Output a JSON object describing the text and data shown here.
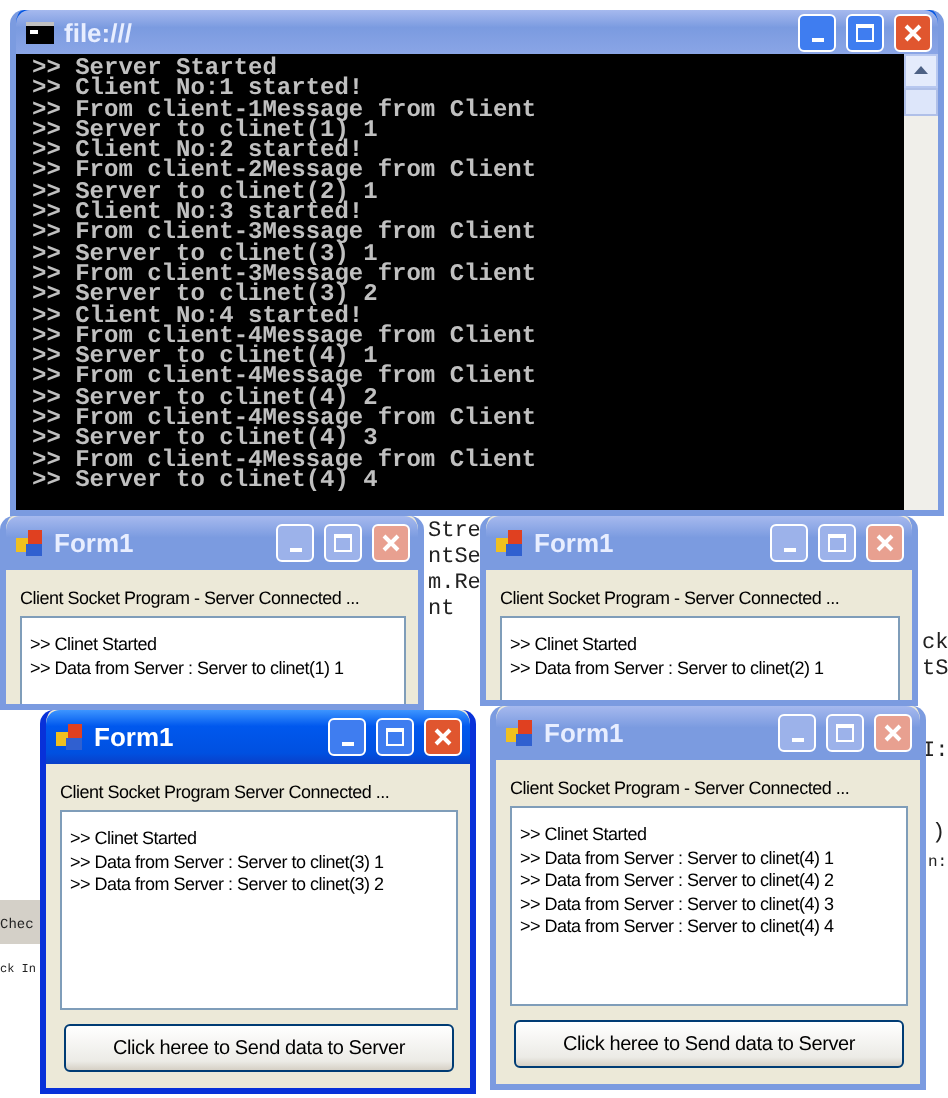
{
  "background_text": [
    "Stre",
    "ntSe",
    "m.Re",
    "nt",
    "ck",
    "tS",
    "I:",
    ")",
    "n:",
    "Chec",
    "ck In"
  ],
  "console": {
    "title": "file:///",
    "lines": [
      ">> Server Started",
      ">> Client No:1 started!",
      ">> From client-1Message from Client",
      ">> Server to clinet(1) 1",
      ">> Client No:2 started!",
      ">> From client-2Message from Client",
      ">> Server to clinet(2) 1",
      ">> Client No:3 started!",
      ">> From client-3Message from Client",
      ">> Server to clinet(3) 1",
      ">> From client-3Message from Client",
      ">> Server to clinet(3) 2",
      ">> Client No:4 started!",
      ">> From client-4Message from Client",
      ">> Server to clinet(4) 1",
      ">> From client-4Message from Client",
      ">> Server to clinet(4) 2",
      ">> From client-4Message from Client",
      ">> Server to clinet(4) 3",
      ">> From client-4Message from Client",
      ">> Server to clinet(4) 4"
    ]
  },
  "forms": [
    {
      "title": "Form1",
      "active": false,
      "status": "Client Socket Program - Server Connected ...",
      "log": [
        ">> Clinet Started",
        ">> Data from Server : Server to clinet(1) 1"
      ]
    },
    {
      "title": "Form1",
      "active": false,
      "status": "Client Socket Program - Server Connected ...",
      "log": [
        ">> Clinet Started",
        ">> Data from Server : Server to clinet(2) 1"
      ]
    },
    {
      "title": "Form1",
      "active": true,
      "status": "Client Socket Program   Server Connected ...",
      "log": [
        ">> Clinet Started",
        ">> Data from Server : Server to clinet(3) 1",
        ">> Data from Server : Server to clinet(3) 2"
      ],
      "button": "Click heree to Send data to Server"
    },
    {
      "title": "Form1",
      "active": false,
      "status": "Client Socket Program - Server Connected ...",
      "log": [
        ">> Clinet Started",
        ">> Data from Server : Server to clinet(4) 1",
        ">> Data from Server : Server to clinet(4) 2",
        ">> Data from Server : Server to clinet(4) 3",
        ">> Data from Server : Server to clinet(4) 4"
      ],
      "button": "Click heree to Send data to Server"
    }
  ]
}
